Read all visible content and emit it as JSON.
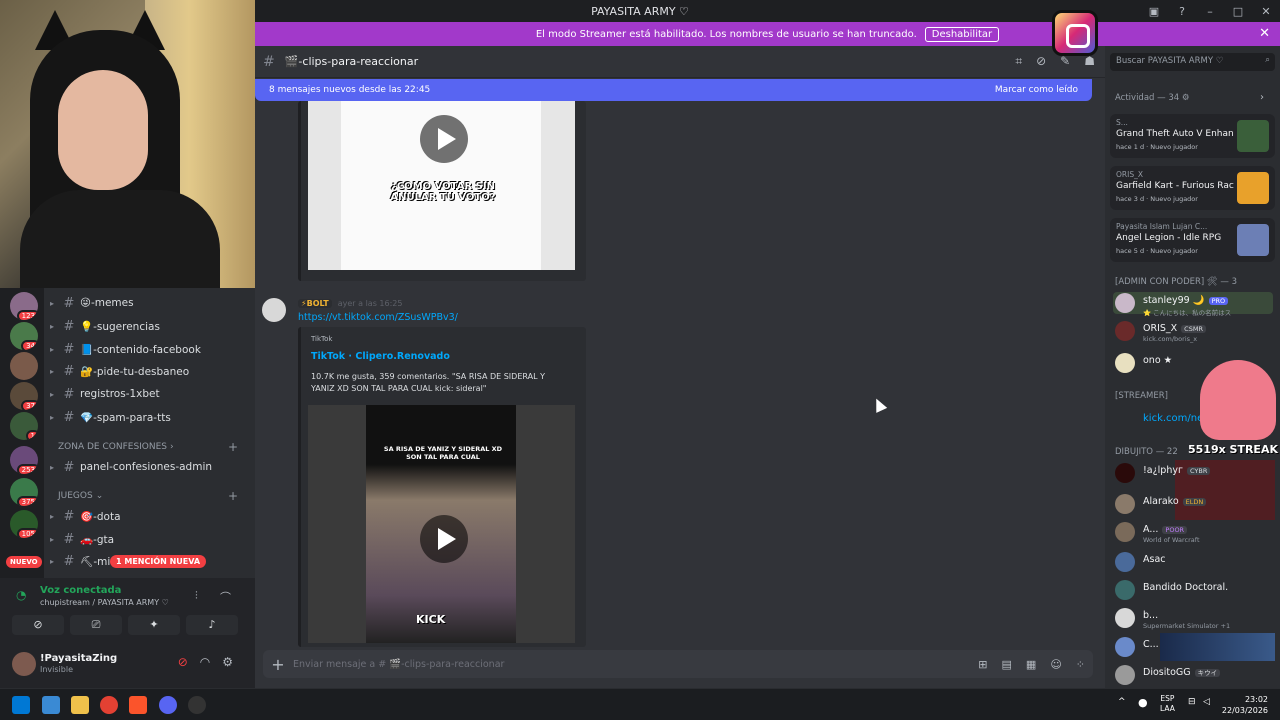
{
  "window": {
    "title": "PAYASITA ARMY ♡"
  },
  "banner": {
    "text": "El modo Streamer está habilitado. Los nombres de usuario se han truncado.",
    "button": "Deshabilitar"
  },
  "channels": {
    "items": [
      "😜-memes",
      "💡-sugerencias",
      "📘-contenido-facebook",
      "🔐-pide-tu-desbaneo",
      "registros-1xbet",
      "💎-spam-para-tts"
    ],
    "category_confesiones": "ZONA DE CONFESIONES",
    "panel": "panel-confesiones-admin",
    "category_juegos": "JUEGOS",
    "games": [
      "🎯-dota",
      "🚗-gta",
      "⛏-min"
    ],
    "badge_nuevo": "NUEVO",
    "badge_mencion": "1 MENCIÓN NUEVA"
  },
  "servers": {
    "badges": [
      "123",
      "34",
      "37",
      "1",
      "253",
      "375",
      "105"
    ]
  },
  "voice": {
    "title": "Voz conectada",
    "sub": "chupistream / PAYASITA ARMY ♡"
  },
  "user": {
    "name": "!PayasitaZing",
    "status": "Invisible"
  },
  "chat": {
    "channel": "🎬-clips-para-reaccionar",
    "newbar_left": "8 mensajes nuevos desde las 22:45",
    "newbar_right": "Marcar como leído",
    "video1_text": "¿COMO VOTAR SIN ANULAR TU VOTO?",
    "msg2_tag": "⚡BOLT",
    "msg2_time": "ayer a las 16:25",
    "msg2_link": "https://vt.tiktok.com/ZSusWPBv3/",
    "embed_provider": "TikTok",
    "embed_title": "TikTok · Clipero.Renovado",
    "embed_desc": "10.7K me gusta, 359 comentarios. \"SA RISA DE SIDERAL Y YANIZ XD SON TAL PARA CUAL kick: sideral\"",
    "video2_caption": "SA RISA DE YANIZ Y SIDERAL XD SON TAL PARA CUAL",
    "video2_kick": "KICK",
    "composer_placeholder": "Enviar mensaje a # 🎬-clips-para-reaccionar"
  },
  "members": {
    "search_placeholder": "Buscar PAYASITA ARMY ♡",
    "activity_header": "Actividad — 34",
    "activities": [
      {
        "user": "S...",
        "game": "Grand Theft Auto V Enhan...",
        "meta": "hace 1 d · Nuevo jugador",
        "color": "#3a5f3a"
      },
      {
        "user": "ORIS_X",
        "game": "Garfield Kart - Furious Rac...",
        "meta": "hace 3 d · Nuevo jugador",
        "color": "#e8a12b"
      },
      {
        "user": "Payasita Islam Lujan C...",
        "game": "Angel Legion - Idle RPG",
        "meta": "hace 5 d · Nuevo jugador",
        "color": "#6c7fb5"
      }
    ],
    "admin_header": "[ADMIN CON PODER] 🛠 — 3",
    "admins": [
      {
        "name": "stanley99 🌙",
        "sub": "⭐ こんにちは、私の名前はス",
        "tag": "PRO"
      },
      {
        "name": "ORIS_X",
        "sub": "kick.com/boris_x",
        "tag": "CSMR"
      },
      {
        "name": "ono ★",
        "sub": "",
        "tag": ""
      }
    ],
    "streamer_header": "[STREAMER]",
    "streamer_link": "kick.com/negangm",
    "streak": "5519x STREAK",
    "dibujito_header": "DIBUJITO — 22",
    "dibujito": [
      {
        "name": "!a¿lphyг",
        "sub": "",
        "tag": "CYBR"
      },
      {
        "name": "Alarako",
        "sub": "",
        "tag": "ELDN"
      },
      {
        "name": "A...",
        "sub": "World of Warcraft",
        "tag": "POOR"
      },
      {
        "name": "Asac",
        "sub": "",
        "tag": ""
      },
      {
        "name": "Bandido Doctoral.",
        "sub": "",
        "tag": ""
      },
      {
        "name": "b...",
        "sub": "Supermarket Simulator +1",
        "tag": ""
      },
      {
        "name": "C...",
        "sub": "",
        "tag": ""
      },
      {
        "name": "DiositoGG",
        "sub": "",
        "tag": "キウイ"
      }
    ]
  },
  "taskbar": {
    "lang1": "ESP",
    "lang2": "LAA",
    "time": "23:02",
    "date": "22/03/2026"
  }
}
